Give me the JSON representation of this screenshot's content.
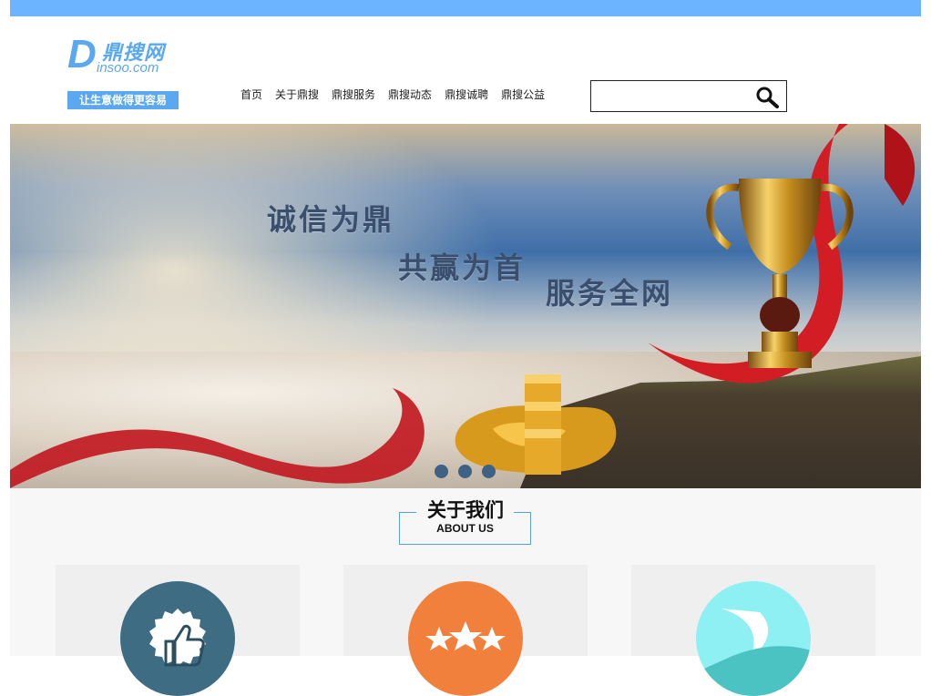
{
  "logo": {
    "letter": "D",
    "name": "鼎搜网",
    "domain": "insoo.com",
    "slogan": "让生意做得更容易"
  },
  "nav": {
    "items": [
      "首页",
      "关于鼎搜",
      "鼎搜服务",
      "鼎搜动态",
      "鼎搜诚聘",
      "鼎搜公益"
    ]
  },
  "search": {
    "placeholder": "",
    "icon": "magnifier-icon"
  },
  "banner": {
    "line1": "诚信为鼎",
    "line2": "共赢为首",
    "line3": "服务全网",
    "slide_count": 3,
    "active_slide": 1
  },
  "about": {
    "title": "关于我们",
    "subtitle": "ABOUT US",
    "cards": [
      {
        "icon": "thumbs-up-icon",
        "color": "#3e6c83"
      },
      {
        "icon": "three-stars-icon",
        "color": "#f0803c"
      },
      {
        "icon": "leaf-swoosh-icon",
        "color": "#8ff0f4"
      }
    ]
  },
  "colors": {
    "topbar": "#6cb4ff",
    "logo_blue": "#5aa8ef",
    "slogan_text": "#3a4f6e",
    "dot": "#3e6184"
  }
}
